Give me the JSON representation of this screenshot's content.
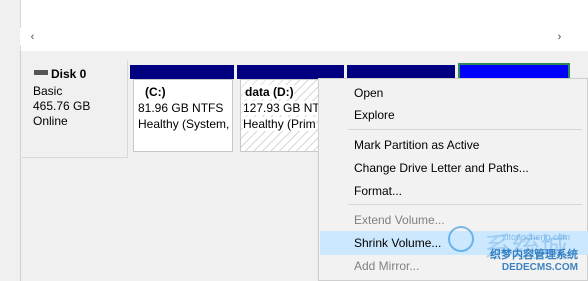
{
  "disk": {
    "title": "Disk 0",
    "type": "Basic",
    "size": "465.76 GB",
    "status": "Online"
  },
  "partitions": [
    {
      "name": "(C:)",
      "size": "81.96 GB NTFS",
      "status": "Healthy (System,"
    },
    {
      "name": "data  (D:)",
      "size": "127.93 GB NTF",
      "status": "Healthy (Prim"
    }
  ],
  "menu": {
    "open": "Open",
    "explore": "Explore",
    "mark_active": "Mark Partition as Active",
    "change_letter": "Change Drive Letter and Paths...",
    "format": "Format...",
    "extend": "Extend Volume...",
    "shrink": "Shrink Volume...",
    "add_mirror": "Add Mirror..."
  },
  "watermark": {
    "big": "系统城",
    "line1": "织梦内容管理系统",
    "line2": "DEDECMS.COM",
    "faint": "xitongcheng.com"
  },
  "colors": {
    "partition_bar": "#000080",
    "selected_bar": "#0000ff",
    "selection_border": "#2e8b57",
    "menu_highlight": "#cce8ff"
  },
  "icons": {
    "scroll_left": "‹",
    "scroll_right": "›"
  }
}
